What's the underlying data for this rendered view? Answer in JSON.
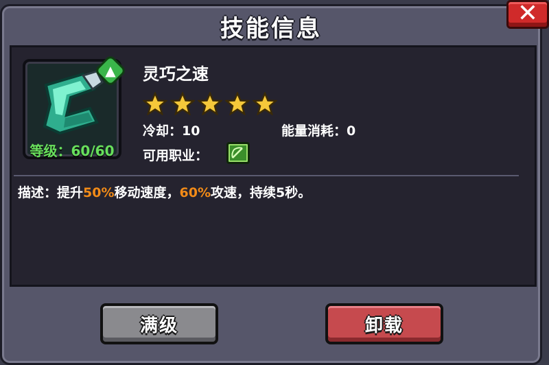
{
  "dialog": {
    "title": "技能信息",
    "close_label": "✕"
  },
  "skill": {
    "name": "灵巧之速",
    "level_label": "等级：60/60",
    "stars": 5,
    "star_color": "#f5c83a",
    "cooldown_label": "冷却：10",
    "energy_label": "能量消耗：0",
    "class_label": "可用职业：",
    "class_icon": "bow-icon",
    "badge_icon": "upgrade-arrow-icon",
    "icon": "green-boot-icon"
  },
  "description": {
    "prefix": "描述：提升",
    "hl1": "50%",
    "mid": "移动速度，",
    "hl2": "60%",
    "suffix": "攻速，持续5秒。",
    "highlight_color": "#f28b18"
  },
  "buttons": {
    "max_level": "满级",
    "unequip": "卸载"
  }
}
